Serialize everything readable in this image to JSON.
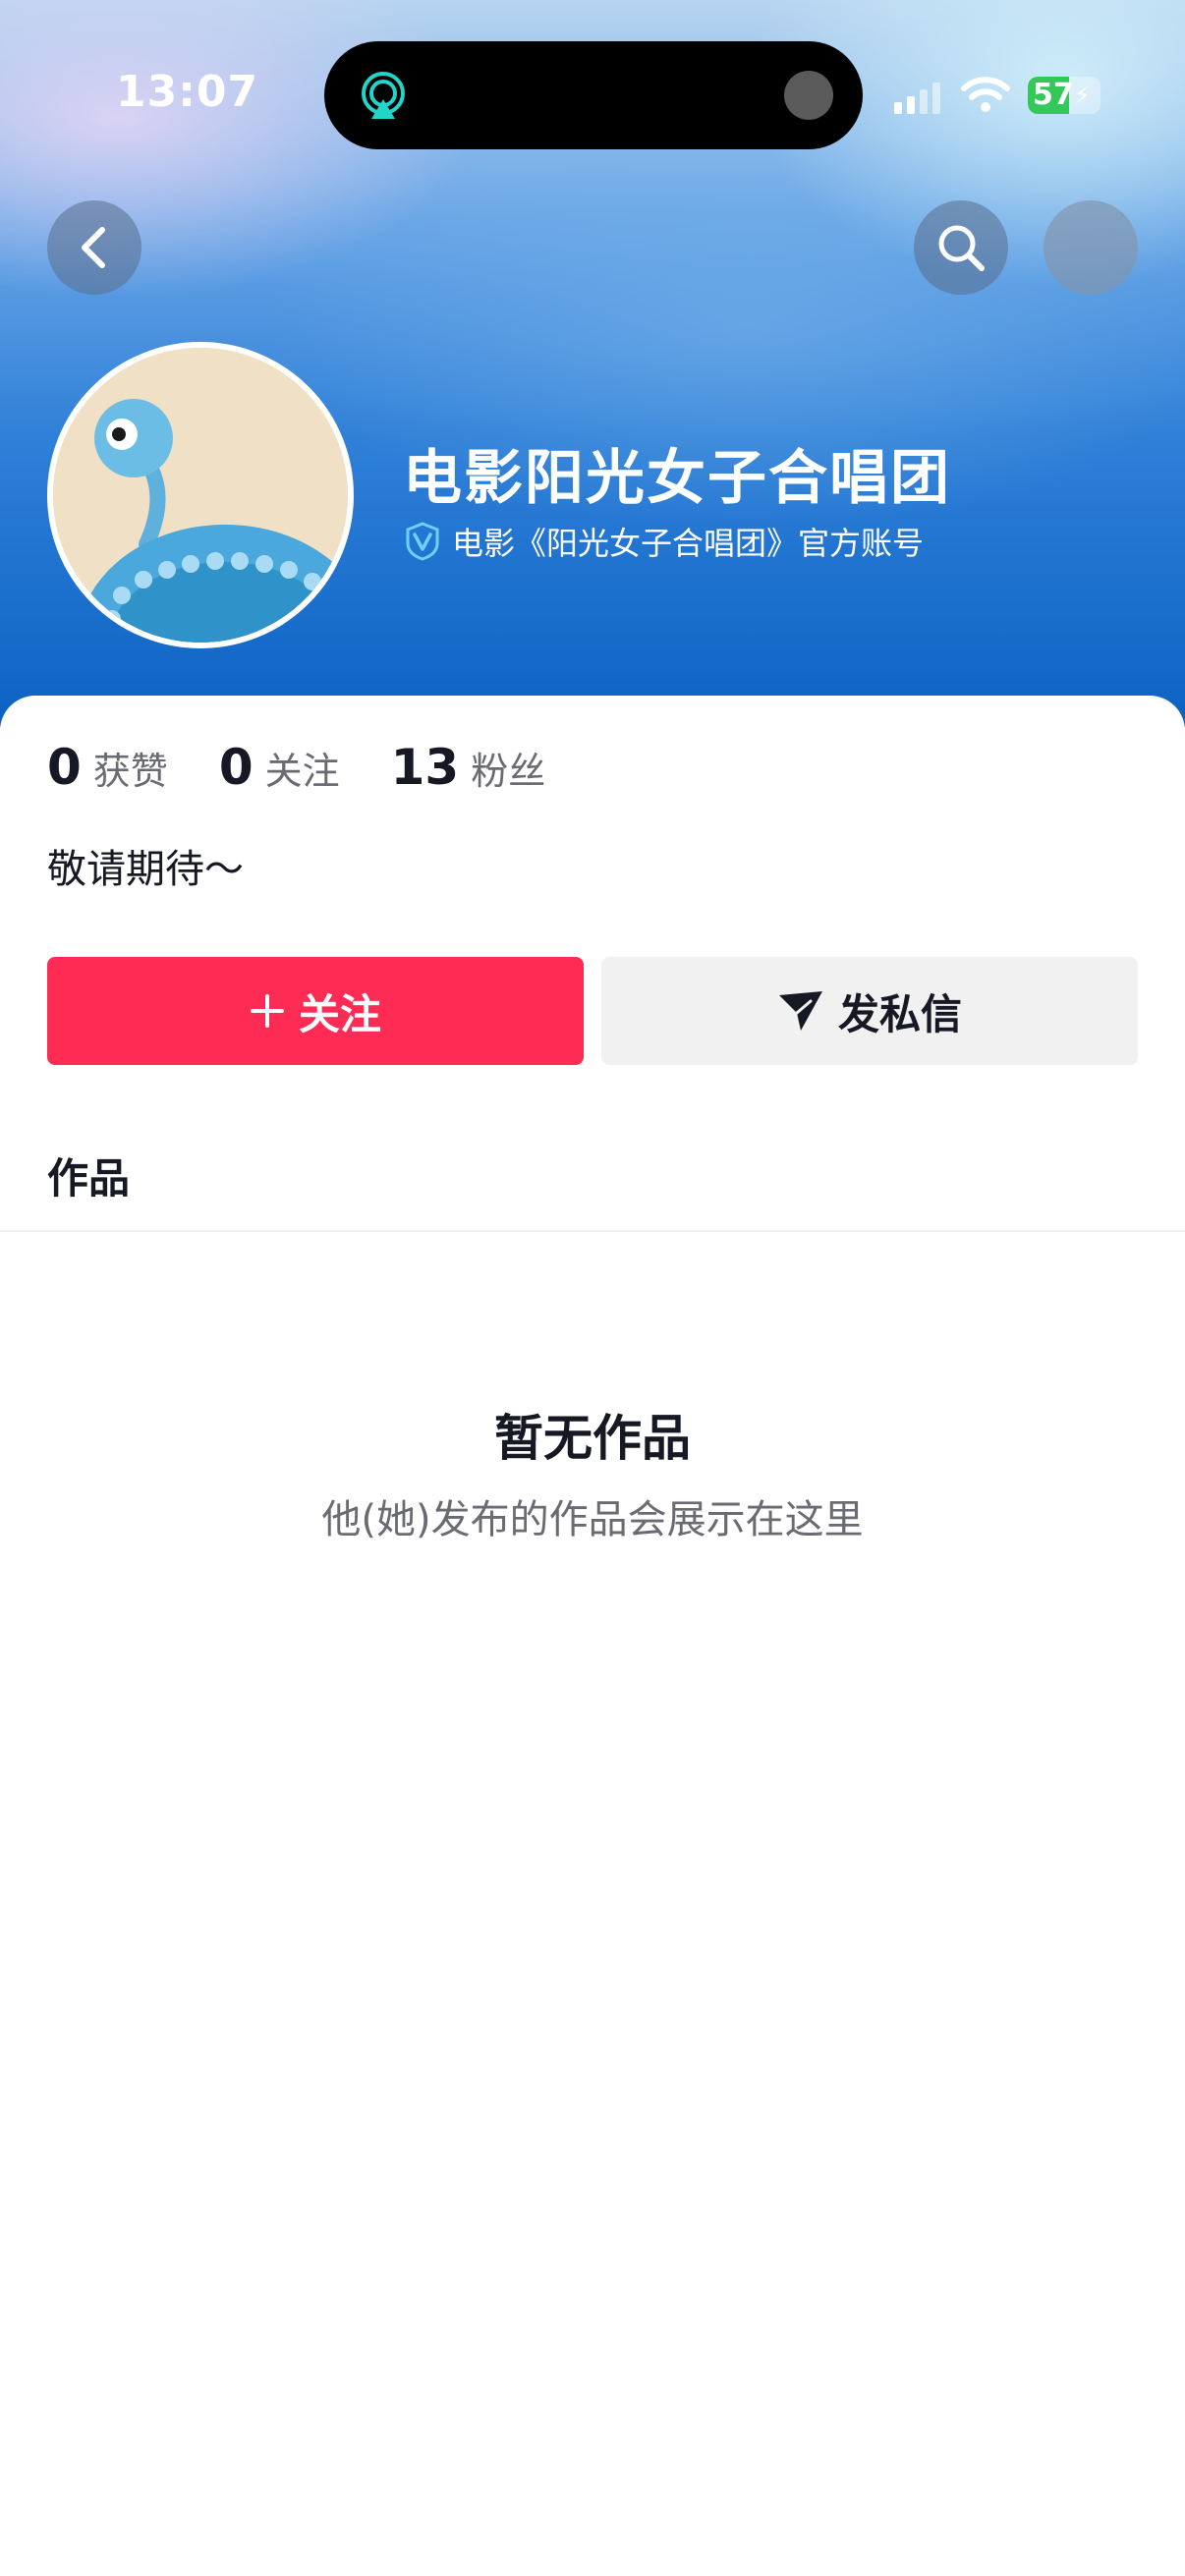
{
  "status_bar": {
    "time": "13:07",
    "battery_level": "57",
    "battery_fraction": 0.57,
    "icons": [
      "live-activity-icon",
      "signal-icon",
      "wifi-icon",
      "battery-icon",
      "charging-bolt-icon"
    ]
  },
  "nav": {
    "icons": [
      "back-chevron-icon",
      "search-icon",
      "more-icon"
    ]
  },
  "profile": {
    "name": "电影阳光女子合唱团",
    "verification_text": "电影《阳光女子合唱团》官方账号",
    "verified_icon": "verified-badge-icon",
    "bio": "敬请期待～"
  },
  "stats": [
    {
      "value": "0",
      "label": "获赞"
    },
    {
      "value": "0",
      "label": "关注"
    },
    {
      "value": "13",
      "label": "粉丝"
    }
  ],
  "actions": {
    "follow_label": "关注",
    "follow_icon": "plus-icon",
    "message_label": "发私信",
    "message_icon": "paper-plane-icon"
  },
  "tabs": {
    "works": "作品"
  },
  "empty_state": {
    "title": "暂无作品",
    "subtitle": "他(她)发布的作品会展示在这里"
  },
  "colors": {
    "accent": "#fe2c55",
    "secondary_button": "#f1f1f2",
    "battery": "#34c759",
    "header_blue": "#2f80d8"
  }
}
